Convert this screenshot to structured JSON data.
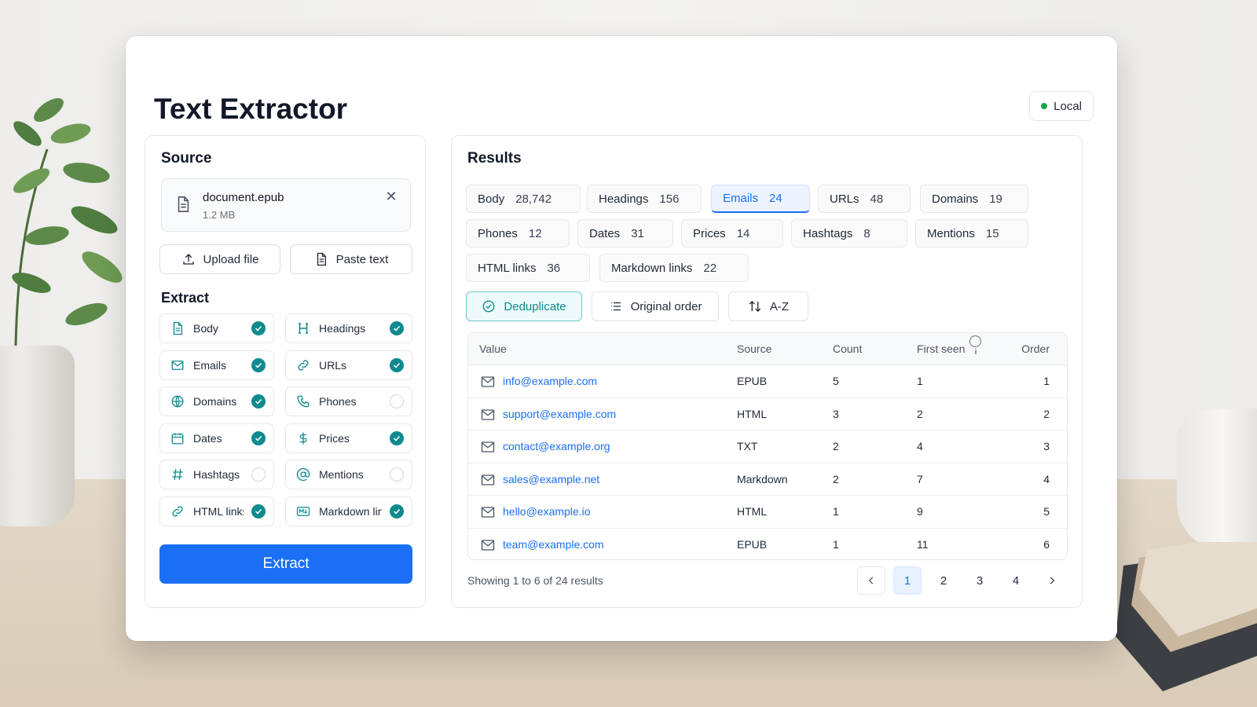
{
  "app": {
    "title": "Text Extractor",
    "badge": "Local",
    "colors": {
      "accent": "#1a6ff4",
      "teal": "#0f8a8f",
      "badge_dot": "#16a34a"
    }
  },
  "source": {
    "heading": "Source",
    "file": {
      "name": "document.epub",
      "size": "1.2 MB"
    },
    "upload_label": "Upload file",
    "paste_label": "Paste text"
  },
  "extract": {
    "heading": "Extract",
    "options": [
      {
        "label": "Body",
        "icon": "document-icon",
        "checked": true
      },
      {
        "label": "Headings",
        "icon": "heading-icon",
        "checked": true
      },
      {
        "label": "Emails",
        "icon": "mail-icon",
        "checked": true
      },
      {
        "label": "URLs",
        "icon": "link-icon",
        "checked": true
      },
      {
        "label": "Domains",
        "icon": "globe-icon",
        "checked": true
      },
      {
        "label": "Phones",
        "icon": "phone-icon",
        "checked": false
      },
      {
        "label": "Dates",
        "icon": "calendar-icon",
        "checked": true
      },
      {
        "label": "Prices",
        "icon": "dollar-icon",
        "checked": true
      },
      {
        "label": "Hashtags",
        "icon": "hash-icon",
        "checked": false
      },
      {
        "label": "Mentions",
        "icon": "at-icon",
        "checked": false
      },
      {
        "label": "HTML links",
        "icon": "link-icon",
        "checked": true
      },
      {
        "label": "Markdown links",
        "icon": "markdown-icon",
        "checked": true
      }
    ],
    "button_label": "Extract"
  },
  "results": {
    "heading": "Results",
    "chips": [
      {
        "label": "Body",
        "count": "28,742"
      },
      {
        "label": "Headings",
        "count": "156"
      },
      {
        "label": "Emails",
        "count": "24",
        "active": true
      },
      {
        "label": "URLs",
        "count": "48"
      },
      {
        "label": "Domains",
        "count": "19"
      },
      {
        "label": "Phones",
        "count": "12"
      },
      {
        "label": "Dates",
        "count": "31"
      },
      {
        "label": "Prices",
        "count": "14"
      },
      {
        "label": "Hashtags",
        "count": "8"
      },
      {
        "label": "Mentions",
        "count": "15"
      },
      {
        "label": "HTML links",
        "count": "36"
      },
      {
        "label": "Markdown links",
        "count": "22"
      }
    ],
    "tools": {
      "dedupe": "Deduplicate",
      "order": "Original order",
      "sort": "A-Z"
    },
    "columns": {
      "value": "Value",
      "source": "Source",
      "count": "Count",
      "first_seen": "First seen",
      "order": "Order"
    },
    "rows": [
      {
        "value": "info@example.com",
        "source": "EPUB",
        "count": "5",
        "first_seen": "1",
        "order": "1"
      },
      {
        "value": "support@example.com",
        "source": "HTML",
        "count": "3",
        "first_seen": "2",
        "order": "2"
      },
      {
        "value": "contact@example.org",
        "source": "TXT",
        "count": "2",
        "first_seen": "4",
        "order": "3"
      },
      {
        "value": "sales@example.net",
        "source": "Markdown",
        "count": "2",
        "first_seen": "7",
        "order": "4"
      },
      {
        "value": "hello@example.io",
        "source": "HTML",
        "count": "1",
        "first_seen": "9",
        "order": "5"
      },
      {
        "value": "team@example.com",
        "source": "EPUB",
        "count": "1",
        "first_seen": "11",
        "order": "6"
      }
    ],
    "showing": "Showing 1 to 6 of 24 results",
    "pages": [
      "1",
      "2",
      "3",
      "4"
    ]
  }
}
